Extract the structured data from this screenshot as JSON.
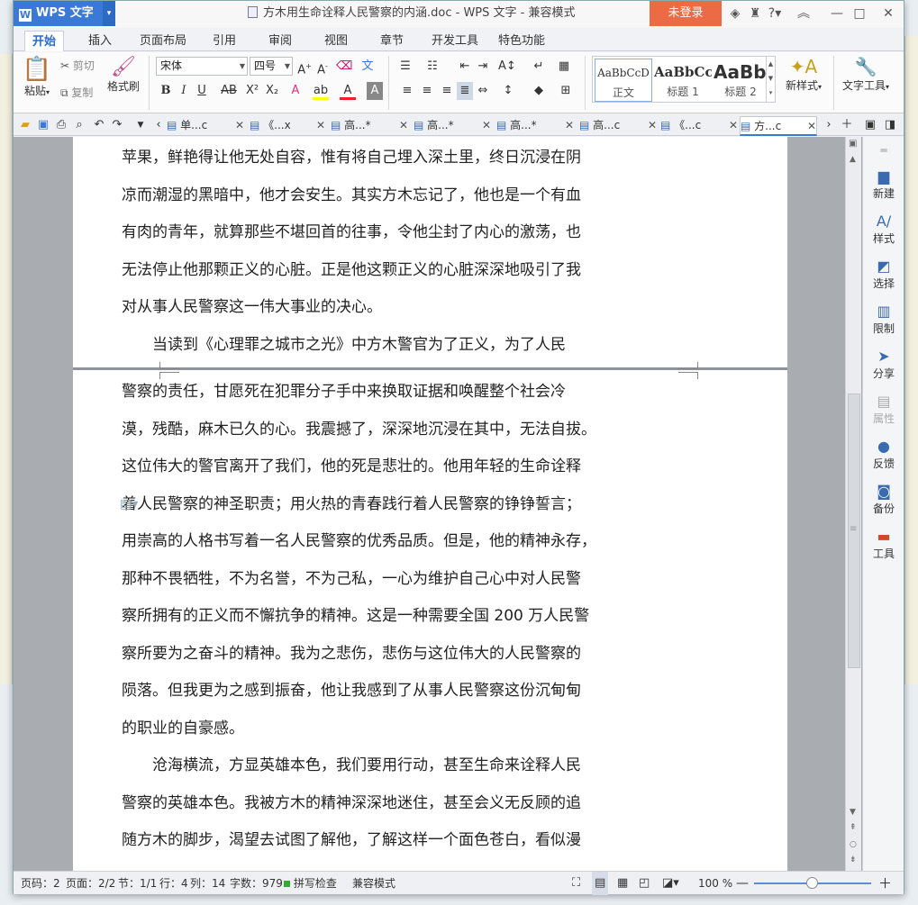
{
  "app": {
    "name": "WPS 文字",
    "logo_letter": "W",
    "dropdown": "▾"
  },
  "window": {
    "title": "方木用生命诠释人民警察的内涵.doc - WPS 文字 - 兼容模式",
    "login_button": "未登录"
  },
  "menu_tabs": [
    "开始",
    "插入",
    "页面布局",
    "引用",
    "审阅",
    "视图",
    "章节",
    "开发工具",
    "特色功能"
  ],
  "ribbon": {
    "paste": "粘贴",
    "cut": "剪切",
    "copy": "复制",
    "format_painter": "格式刷",
    "font_name": "宋体",
    "font_size": "四号",
    "styles": [
      {
        "preview": "AaBbCcD",
        "label": "正文"
      },
      {
        "preview": "AaBbCcI",
        "label": "标题 1"
      },
      {
        "preview": "AaBb(",
        "label": "标题 2"
      }
    ],
    "new_style": "新样式",
    "text_tools": "文字工具"
  },
  "doc_tabs": [
    {
      "label": "单...c"
    },
    {
      "label": "《...x"
    },
    {
      "label": "高...*"
    },
    {
      "label": "高...*"
    },
    {
      "label": "高...*"
    },
    {
      "label": "高...c"
    },
    {
      "label": "《...c"
    },
    {
      "label": "方...c"
    }
  ],
  "document": {
    "page1_lines": [
      "苹果，鲜艳得让他无处自容，惟有将自己埋入深土里，终日沉浸在阴",
      "凉而潮湿的黑暗中，他才会安生。其实方木忘记了，他也是一个有血",
      "有肉的青年，就算那些不堪回首的往事，令他尘封了内心的激荡，也",
      "无法停止他那颗正义的心脏。正是他这颗正义的心脏深深地吸引了我",
      "对从事人民警察这一伟大事业的决心。",
      "　　当读到《心理罪之城市之光》中方木警官为了正义，为了人民"
    ],
    "page2_lines": [
      "警察的责任，甘愿死在犯罪分子手中来换取证据和唤醒整个社会冷",
      "漠，残酷，麻木已久的心。我震撼了，深深地沉浸在其中，无法自拔。",
      "这位伟大的警官离开了我们，他的死是悲壮的。他用年轻的生命诠释",
      "着人民警察的神圣职责；用火热的青春践行着人民警察的铮铮誓言；",
      "用崇高的人格书写着一名人民警察的优秀品质。但是，他的精神永存，",
      "那种不畏牺牲，不为名誉，不为己私，一心为维护自己心中对人民警",
      "察所拥有的正义而不懈抗争的精神。这是一种需要全国 200 万人民警",
      "察所要为之奋斗的精神。我为之悲伤，悲伤与这位伟大的人民警察的",
      "陨落。但我更为之感到振奋，他让我感到了从事人民警察这份沉甸甸",
      "的职业的自豪感。",
      "　　沧海横流，方显英雄本色，我们要用行动，甚至生命来诠释人民",
      "警察的英雄本色。我被方木的精神深深地迷住，甚至会义无反顾的追",
      "随方木的脚步，渴望去试图了解他，了解这样一个面色苍白，看似漫"
    ]
  },
  "side_panel": [
    "新建",
    "样式",
    "选择",
    "限制",
    "分享",
    "属性",
    "反馈",
    "备份",
    "工具"
  ],
  "status": {
    "page_no": "页码：2",
    "pages": "页面：2/2",
    "section": "节：1/1",
    "row": "行：4",
    "col": "列：14",
    "word_count": "字数：979",
    "spell_check": "拼写检查",
    "compat_mode": "兼容模式",
    "zoom": "100 %"
  }
}
